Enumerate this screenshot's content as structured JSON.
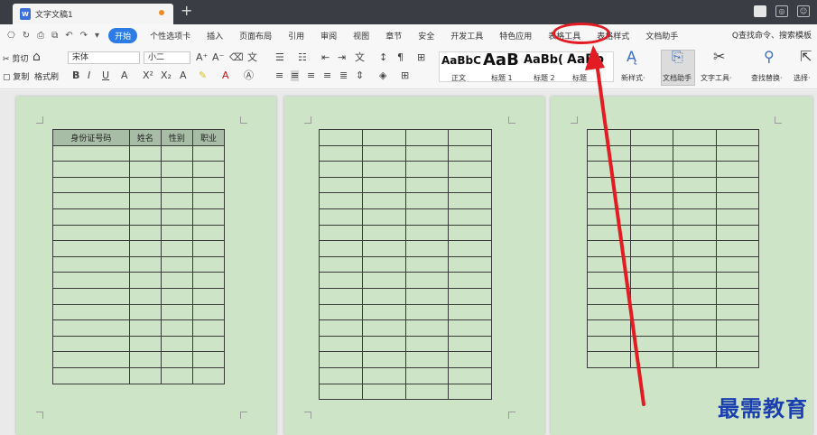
{
  "titlebar": {
    "doc_tab": "文字文稿1",
    "new_tab": "+"
  },
  "quick_access": [
    "⎔",
    "↻",
    "⎙",
    "⧉",
    "↶",
    "↷",
    "▾"
  ],
  "menu": {
    "items": [
      "开始",
      "个性选项卡",
      "插入",
      "页面布局",
      "引用",
      "审阅",
      "视图",
      "章节",
      "安全",
      "开发工具",
      "特色应用",
      "表格工具",
      "表格样式",
      "文档助手"
    ],
    "active": "开始",
    "search": "Q查找命令、搜索模板"
  },
  "ribbon": {
    "cut": "✂ 剪切",
    "copy": "复制",
    "format_painter": "格式刷",
    "font_name": "宋体",
    "font_size": "小二",
    "styles": [
      {
        "sample": "AaBbC",
        "label": "正文"
      },
      {
        "sample": "AaB",
        "label": "标题 1"
      },
      {
        "sample": "AaBb(",
        "label": "标题 2"
      },
      {
        "sample": "AaBb",
        "label": "标题"
      }
    ],
    "new_style": "新样式·",
    "doc_assistant": "文档助手",
    "text_tools": "文字工具·",
    "find_replace": "查找替换·",
    "select": "选择·"
  },
  "pages": [
    {
      "headers": [
        "身份证号码",
        "姓名",
        "性别",
        "职业"
      ],
      "rows": 16
    },
    {
      "headers": [
        "",
        "",
        "",
        ""
      ],
      "rows": 17
    },
    {
      "headers": [
        "",
        "",
        "",
        ""
      ],
      "rows": 15
    }
  ],
  "annotation": {
    "highlighted_menu": "表格工具",
    "arrow_color": "#e31b23"
  },
  "watermark": "最需教育"
}
